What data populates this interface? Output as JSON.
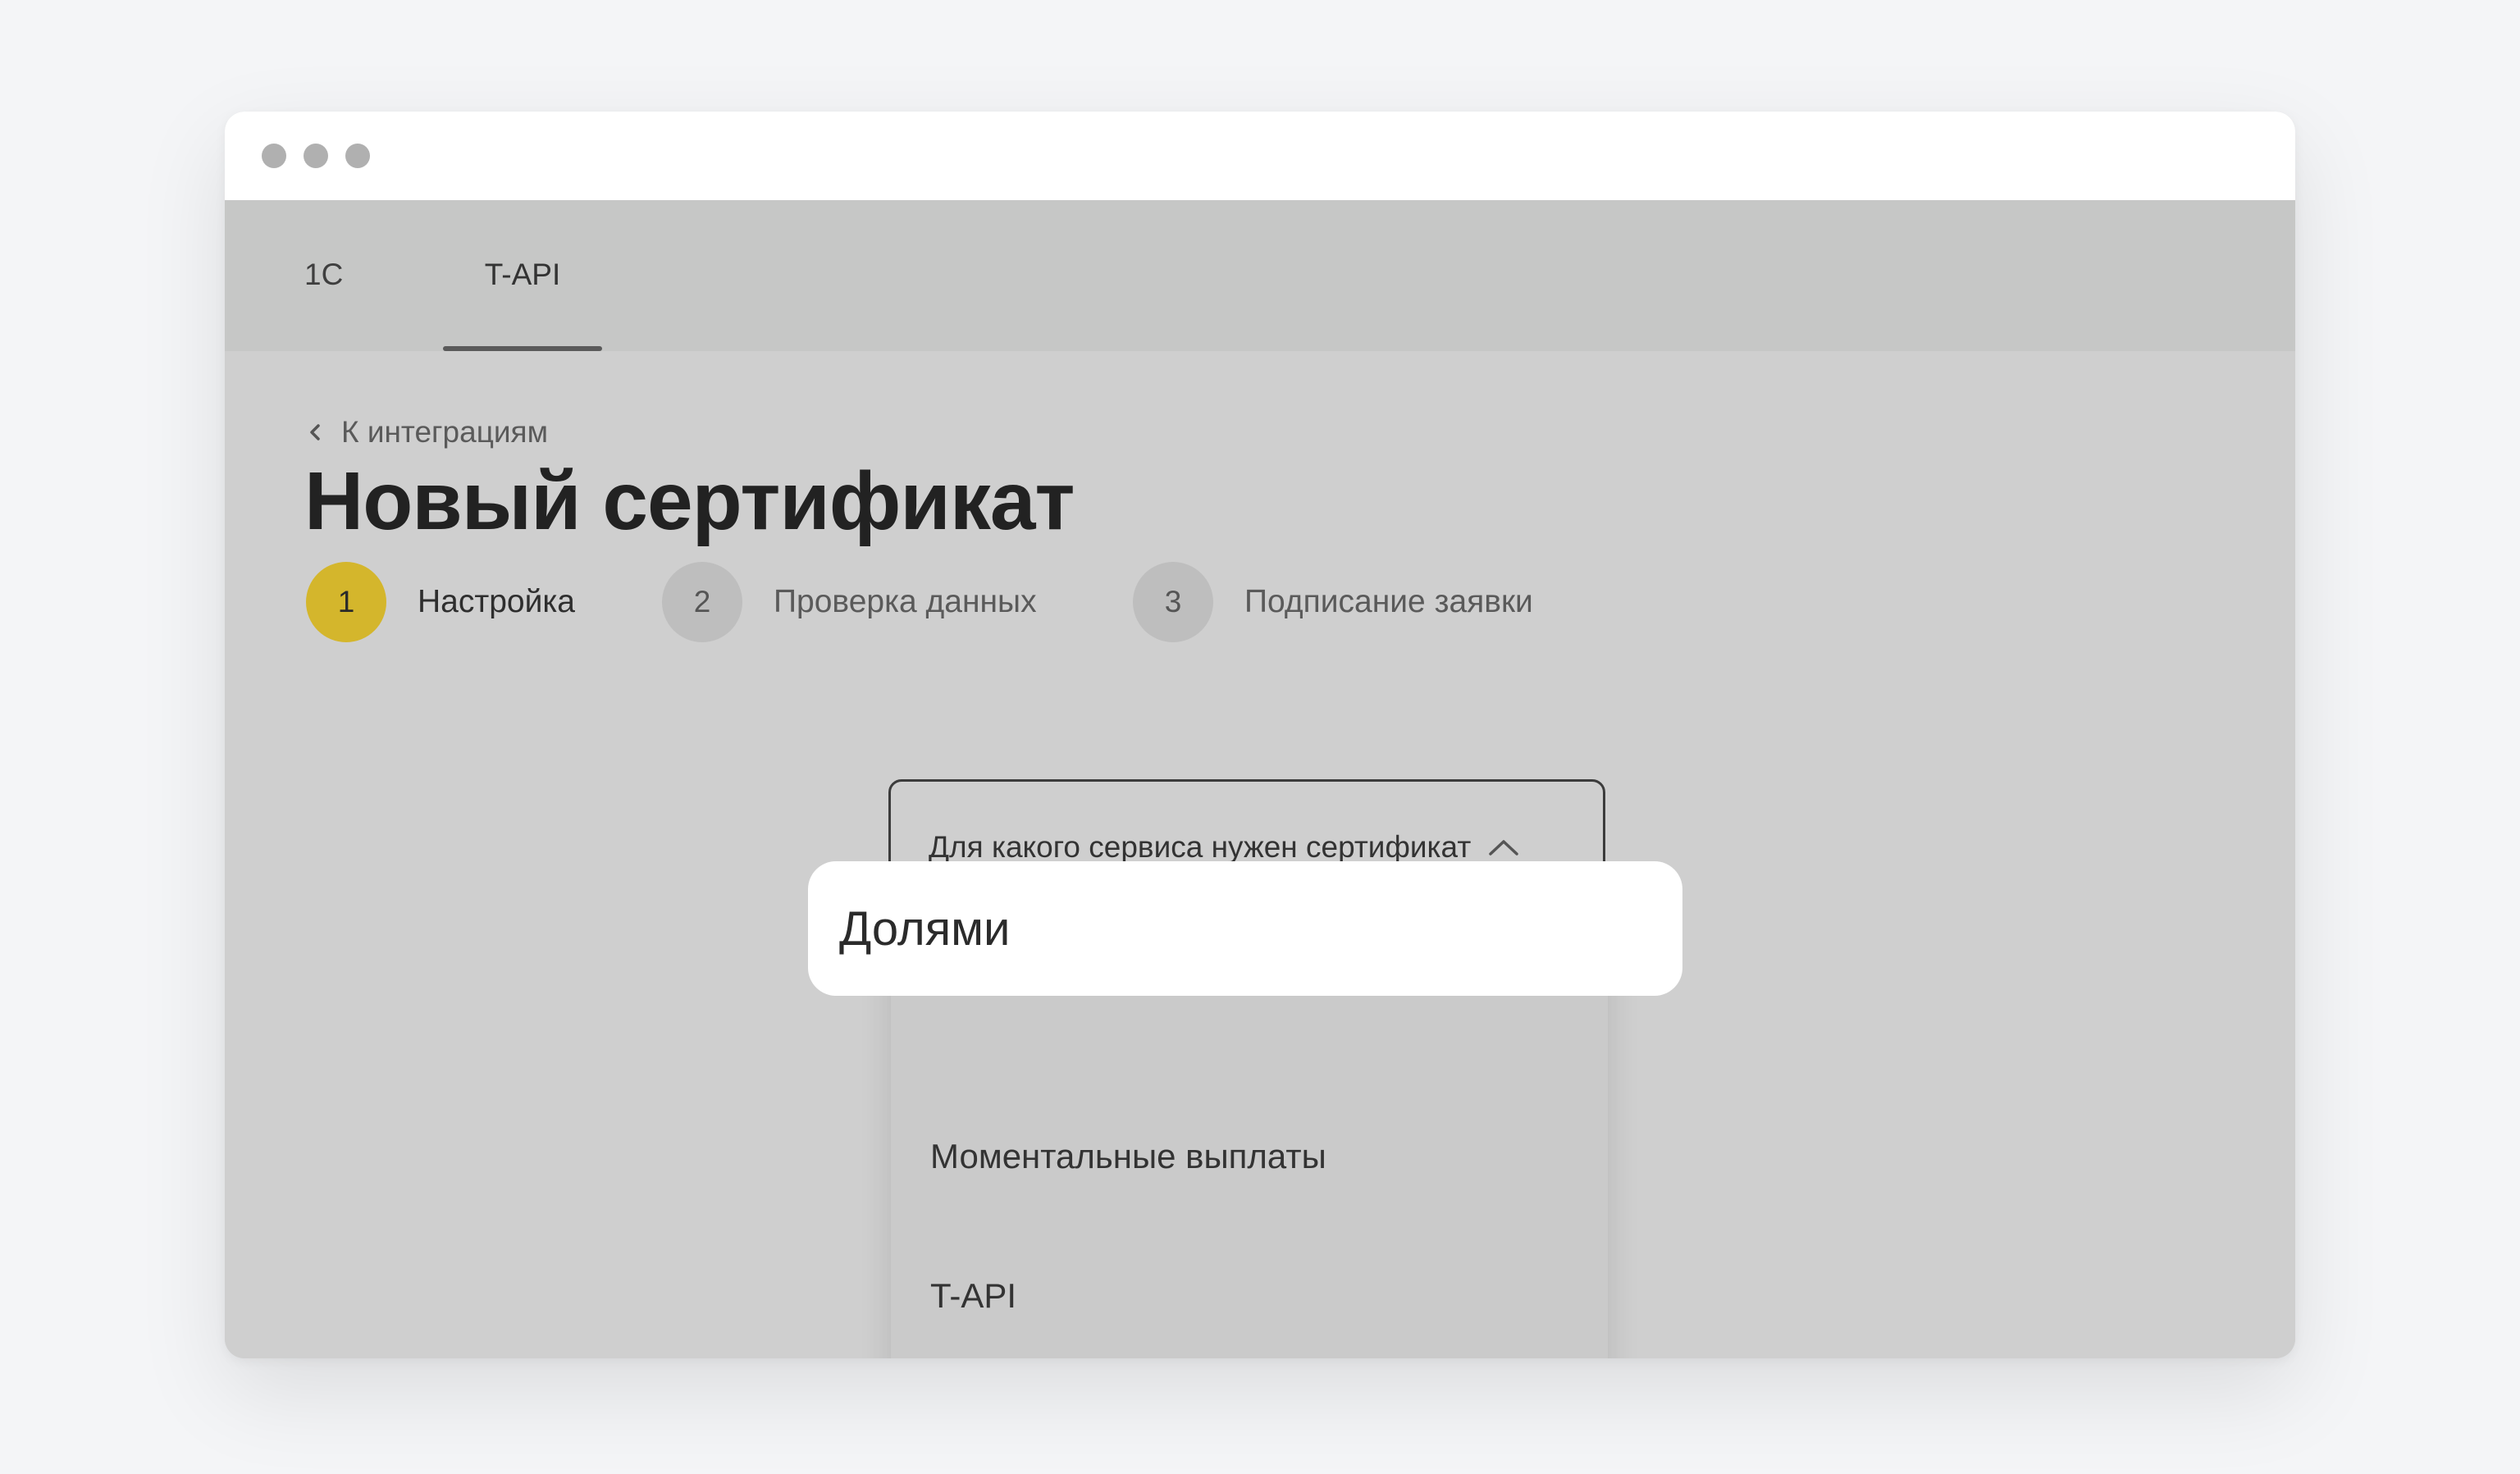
{
  "tabs": [
    {
      "label": "1С"
    },
    {
      "label": "T-API"
    }
  ],
  "back_link": {
    "label": "К интеграциям"
  },
  "page_title": "Новый сертификат",
  "steps": [
    {
      "number": "1",
      "label": "Настройка"
    },
    {
      "number": "2",
      "label": "Проверка данных"
    },
    {
      "number": "3",
      "label": "Подписание заявки"
    }
  ],
  "select": {
    "label": "Для какого сервиса нужен сертификат"
  },
  "dropdown": {
    "options": [
      {
        "label": "Долями"
      },
      {
        "label": "Моментальные выплаты"
      },
      {
        "label": "T-API"
      }
    ]
  },
  "colors": {
    "active_step": "#d4b62c",
    "overlay_gray": "#cfcfcf",
    "highlight_bg": "#ffffff"
  }
}
